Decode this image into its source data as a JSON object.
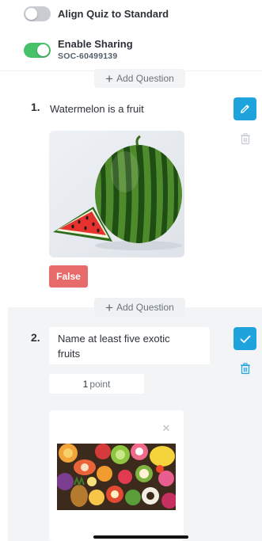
{
  "settings": {
    "align_quiz": {
      "label": "Align Quiz to Standard",
      "enabled": false
    },
    "enable_sharing": {
      "label": "Enable Sharing",
      "code": "SOC-60499139",
      "enabled": true
    }
  },
  "add_question_label": "Add Question",
  "questions": [
    {
      "number": "1.",
      "text": "Watermelon is a fruit",
      "answer": "False",
      "image": "watermelon-image",
      "action_icon": "pencil-icon"
    },
    {
      "number": "2.",
      "text": "Name at least five exotic fruits",
      "points_value": "1",
      "points_unit": "point",
      "image": "exotic-fruits-image",
      "action_icon": "check-icon"
    }
  ],
  "colors": {
    "accent_blue": "#1fa3dd",
    "toggle_on": "#47c16a",
    "toggle_off": "#c9ccd1",
    "false_badge": "#e86b6b",
    "section_bg": "#f2f4f6"
  }
}
